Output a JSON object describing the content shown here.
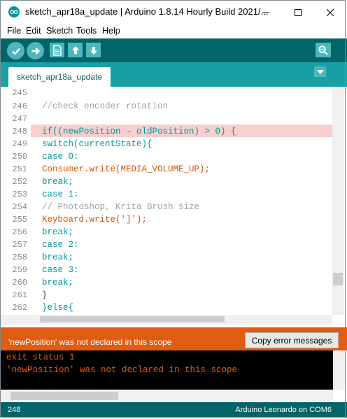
{
  "window": {
    "title": "sketch_apr18a_update | Arduino 1.8.14 Hourly Build 2021/...",
    "icon": "arduino-logo-icon",
    "controls": [
      "minimize-icon",
      "maximize-icon",
      "close-icon"
    ]
  },
  "menubar": {
    "items": [
      "File",
      "Edit",
      "Sketch",
      "Tools",
      "Help"
    ]
  },
  "toolbar": {
    "buttons": [
      "verify-icon",
      "upload-icon",
      "new-icon",
      "open-icon",
      "save-icon"
    ],
    "right_button": "serial-monitor-icon"
  },
  "tabs": {
    "items": [
      {
        "label": "sketch_apr18a_update"
      }
    ],
    "menu_icon": "tab-menu-icon"
  },
  "editor": {
    "highlighted_line": "248",
    "lines": [
      {
        "num": "245",
        "code": ""
      },
      {
        "num": "246",
        "code": "//check encoder rotation"
      },
      {
        "num": "247",
        "code": ""
      },
      {
        "num": "248",
        "code": "if((newPosition - oldPosition) > 0) {"
      },
      {
        "num": "249",
        "code": "switch(currentState){"
      },
      {
        "num": "250",
        "code": "case 0:"
      },
      {
        "num": "251",
        "code": "Consumer.write(MEDIA_VOLUME_UP);"
      },
      {
        "num": "252",
        "code": "break;"
      },
      {
        "num": "253",
        "code": "case 1:"
      },
      {
        "num": "254",
        "code": "// Photoshop, Krita Brush size"
      },
      {
        "num": "255",
        "code": "Keyboard.write(']');"
      },
      {
        "num": "256",
        "code": "break;"
      },
      {
        "num": "257",
        "code": "case 2:"
      },
      {
        "num": "258",
        "code": "break;"
      },
      {
        "num": "259",
        "code": "case 3:"
      },
      {
        "num": "260",
        "code": "break;"
      },
      {
        "num": "261",
        "code": "}"
      },
      {
        "num": "262",
        "code": "}else{"
      }
    ]
  },
  "error_bar": {
    "message": "'newPosition' was not declared in this scope",
    "copy_button": "Copy error messages",
    "color": "#e05c12"
  },
  "console": {
    "lines": [
      "exit status 1",
      "'newPosition' was not declared in this scope"
    ]
  },
  "statusbar": {
    "line": "248",
    "board": "Arduino Leonardo on COM6"
  },
  "colors": {
    "toolbar": "#006468",
    "tabstrip": "#17a1a5",
    "button": "#4db7bb",
    "highlight": "#f7cfcf"
  }
}
